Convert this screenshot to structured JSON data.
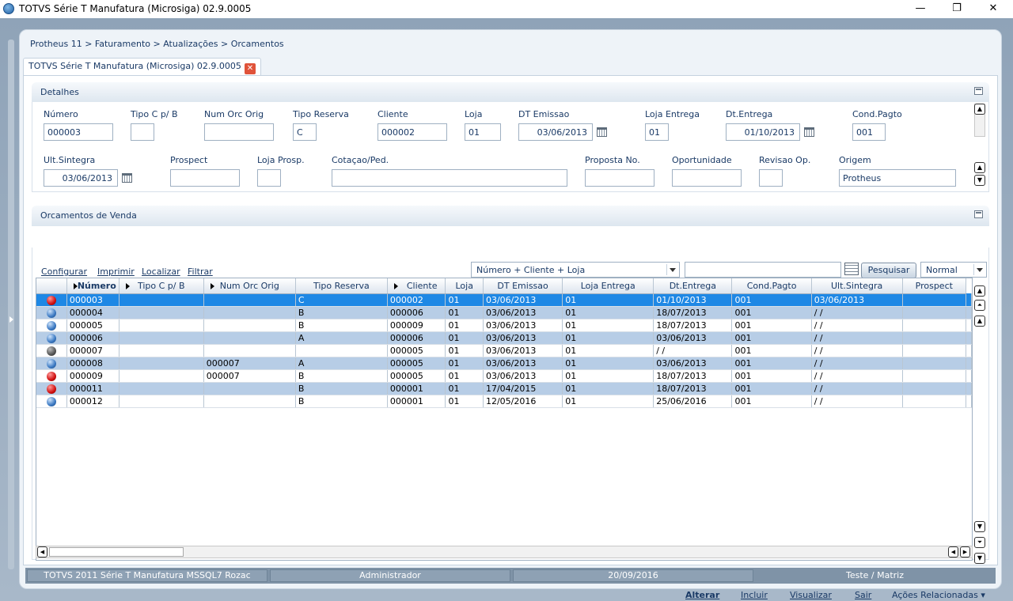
{
  "window": {
    "title": "TOTVS Série T Manufatura (Microsiga) 02.9.0005",
    "min": "—",
    "max": "❐",
    "close": "✕"
  },
  "breadcrumb": "Protheus 11 > Faturamento > Atualizações > Orcamentos",
  "tab": {
    "label": "TOTVS Série T Manufatura (Microsiga) 02.9.0005",
    "close": "✕"
  },
  "details": {
    "title": "Detalhes",
    "fields": {
      "numero": {
        "label": "Número",
        "value": "000003"
      },
      "tipo_cpb": {
        "label": "Tipo C p/ B",
        "value": ""
      },
      "num_orc_orig": {
        "label": "Num Orc Orig",
        "value": ""
      },
      "tipo_reserva": {
        "label": "Tipo Reserva",
        "value": "C"
      },
      "cliente": {
        "label": "Cliente",
        "value": "000002"
      },
      "loja": {
        "label": "Loja",
        "value": "01"
      },
      "dt_emissao": {
        "label": "DT Emissao",
        "value": "03/06/2013"
      },
      "loja_entrega": {
        "label": "Loja Entrega",
        "value": "01"
      },
      "dt_entrega": {
        "label": "Dt.Entrega",
        "value": "01/10/2013"
      },
      "cond_pagto": {
        "label": "Cond.Pagto",
        "value": "001"
      },
      "ult_sintegra": {
        "label": "Ult.Sintegra",
        "value": "03/06/2013"
      },
      "prospect": {
        "label": "Prospect",
        "value": ""
      },
      "loja_prosp": {
        "label": "Loja Prosp.",
        "value": ""
      },
      "cotacao_ped": {
        "label": "Cotaçao/Ped.",
        "value": ""
      },
      "proposta_no": {
        "label": "Proposta No.",
        "value": ""
      },
      "oportunidade": {
        "label": "Oportunidade",
        "value": ""
      },
      "revisao_op": {
        "label": "Revisao Op.",
        "value": ""
      },
      "origem": {
        "label": "Origem",
        "value": "Protheus"
      }
    }
  },
  "orcamentos": {
    "title": "Orcamentos de Venda",
    "links": {
      "configurar": "Configurar",
      "imprimir": "Imprimir",
      "localizar": "Localizar",
      "filtrar": "Filtrar"
    },
    "index_select": "Número + Cliente + Loja",
    "search_value": "",
    "search_button": "Pesquisar",
    "mode_select": "Normal",
    "columns": [
      "Número",
      "Tipo C p/ B",
      "Num Orc Orig",
      "Tipo Reserva",
      "Cliente",
      "Loja",
      "DT Emissao",
      "Loja Entrega",
      "Dt.Entrega",
      "Cond.Pagto",
      "Ult.Sintegra",
      "Prospect"
    ],
    "rows": [
      {
        "status": "red",
        "cells": [
          "000003",
          "",
          "",
          "C",
          "000002",
          "01",
          "03/06/2013",
          "01",
          "01/10/2013",
          "001",
          "03/06/2013",
          ""
        ]
      },
      {
        "status": "blue",
        "cells": [
          "000004",
          "",
          "",
          "B",
          "000006",
          "01",
          "03/06/2013",
          "01",
          "18/07/2013",
          "001",
          " / /",
          ""
        ]
      },
      {
        "status": "blue",
        "cells": [
          "000005",
          "",
          "",
          "B",
          "000009",
          "01",
          "03/06/2013",
          "01",
          "18/07/2013",
          "001",
          " / /",
          ""
        ]
      },
      {
        "status": "blue",
        "cells": [
          "000006",
          "",
          "",
          "A",
          "000006",
          "01",
          "03/06/2013",
          "01",
          "03/06/2013",
          "001",
          " / /",
          ""
        ]
      },
      {
        "status": "gray",
        "cells": [
          "000007",
          "",
          "",
          "",
          "000005",
          "01",
          "03/06/2013",
          "01",
          " / /",
          "001",
          " / /",
          ""
        ]
      },
      {
        "status": "blue",
        "cells": [
          "000008",
          "",
          "000007",
          "A",
          "000005",
          "01",
          "03/06/2013",
          "01",
          "03/06/2013",
          "001",
          " / /",
          ""
        ]
      },
      {
        "status": "red",
        "cells": [
          "000009",
          "",
          "000007",
          "B",
          "000005",
          "01",
          "03/06/2013",
          "01",
          "18/07/2013",
          "001",
          " / /",
          ""
        ]
      },
      {
        "status": "red",
        "cells": [
          "000011",
          "",
          "",
          "B",
          "000001",
          "01",
          "17/04/2015",
          "01",
          "18/07/2013",
          "001",
          " / /",
          ""
        ]
      },
      {
        "status": "blue",
        "cells": [
          "000012",
          "",
          "",
          "B",
          "000001",
          "01",
          "12/05/2016",
          "01",
          "25/06/2016",
          "001",
          " / /",
          ""
        ]
      }
    ]
  },
  "actions": {
    "alterar": "Alterar",
    "incluir": "Incluir",
    "visualizar": "Visualizar",
    "sair": "Sair",
    "acoes": "Ações Relacionadas"
  },
  "status": {
    "system": "TOTVS 2011 Série T Manufatura MSSQL7 Rozac",
    "user": "Administrador",
    "date": "20/09/2016",
    "company": "Teste / Matriz"
  },
  "colors": {
    "accent": "#1e88e5",
    "alt_row": "#b7cde6",
    "status_red": "#d01010",
    "status_blue": "#3a78c2",
    "status_gray": "#555555"
  }
}
